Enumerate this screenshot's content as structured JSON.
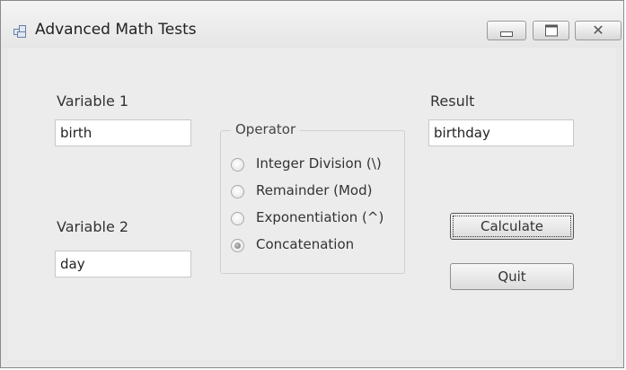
{
  "window": {
    "title": "Advanced Math Tests",
    "controls": {
      "minimize": "minimize-icon",
      "maximize": "maximize-icon",
      "close": "close-icon"
    }
  },
  "form": {
    "variable1": {
      "label": "Variable 1",
      "value": "birth"
    },
    "variable2": {
      "label": "Variable 2",
      "value": "day"
    },
    "result": {
      "label": "Result",
      "value": "birthday"
    },
    "operator": {
      "legend": "Operator",
      "options": [
        {
          "label": "Integer Division (\\)",
          "checked": false
        },
        {
          "label": "Remainder (Mod)",
          "checked": false
        },
        {
          "label": "Exponentiation (^)",
          "checked": false
        },
        {
          "label": "Concatenation",
          "checked": true
        }
      ]
    },
    "buttons": {
      "calculate": "Calculate",
      "quit": "Quit"
    }
  }
}
